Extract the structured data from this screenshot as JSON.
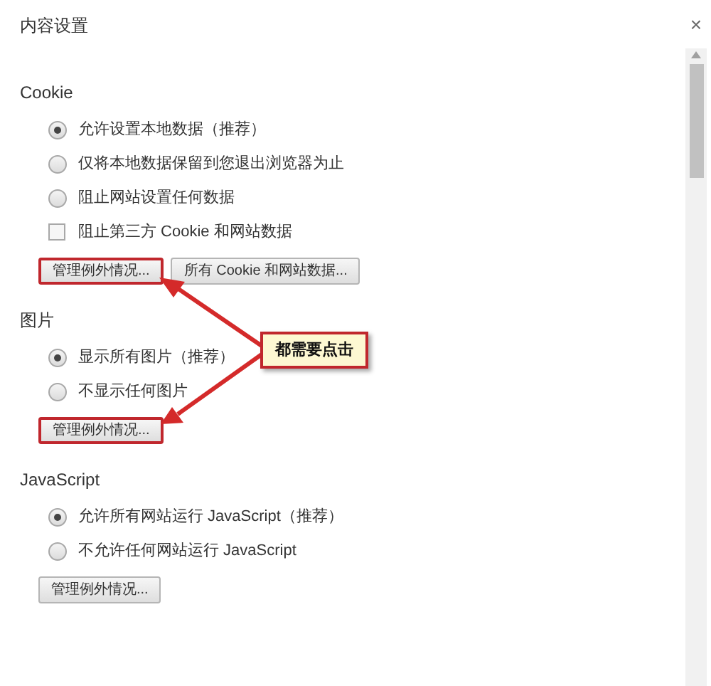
{
  "window": {
    "title": "内容设置",
    "close": "×"
  },
  "sections": [
    {
      "heading": "Cookie",
      "options": [
        {
          "kind": "radio",
          "label": "允许设置本地数据（推荐）",
          "selected": true
        },
        {
          "kind": "radio",
          "label": "仅将本地数据保留到您退出浏览器为止",
          "selected": false
        },
        {
          "kind": "radio",
          "label": "阻止网站设置任何数据",
          "selected": false
        },
        {
          "kind": "checkbox",
          "label": "阻止第三方 Cookie 和网站数据",
          "checked": false
        }
      ],
      "buttons": [
        {
          "label": "管理例外情况...",
          "highlighted": true
        },
        {
          "label": "所有 Cookie 和网站数据...",
          "highlighted": false
        }
      ]
    },
    {
      "heading": "图片",
      "options": [
        {
          "kind": "radio",
          "label": "显示所有图片（推荐）",
          "selected": true
        },
        {
          "kind": "radio",
          "label": "不显示任何图片",
          "selected": false
        }
      ],
      "buttons": [
        {
          "label": "管理例外情况...",
          "highlighted": true
        }
      ]
    },
    {
      "heading": "JavaScript",
      "options": [
        {
          "kind": "radio",
          "label": "允许所有网站运行 JavaScript（推荐）",
          "selected": true
        },
        {
          "kind": "radio",
          "label": "不允许任何网站运行 JavaScript",
          "selected": false
        }
      ],
      "buttons": [
        {
          "label": "管理例外情况...",
          "highlighted": false
        }
      ]
    }
  ],
  "annotation": {
    "text": "都需要点击"
  }
}
